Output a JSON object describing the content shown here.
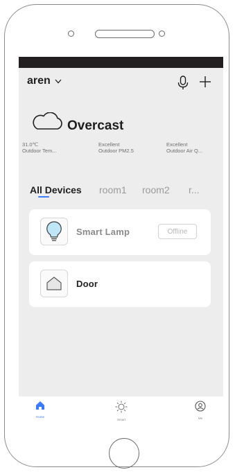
{
  "header": {
    "home_name": "aren"
  },
  "weather": {
    "condition": "Overcast",
    "stats": [
      {
        "value": "31.0℃",
        "label": "Outdoor Tem..."
      },
      {
        "value": "Excellent",
        "label": "Outdoor PM2.5"
      },
      {
        "value": "Excellent",
        "label": "Outdoor Air Q..."
      }
    ]
  },
  "tabs": [
    {
      "label": "All Devices",
      "active": true
    },
    {
      "label": "room1",
      "active": false
    },
    {
      "label": "room2",
      "active": false
    },
    {
      "label": "r...",
      "active": false
    }
  ],
  "devices": [
    {
      "name": "Smart  Lamp",
      "icon": "lightbulb-icon",
      "status": "Offline"
    },
    {
      "name": "Door",
      "icon": "house-icon",
      "status": ""
    }
  ],
  "tabbar": {
    "items": [
      {
        "label": "Home",
        "icon": "home-icon",
        "active": true
      },
      {
        "label": "Smart",
        "icon": "sun-icon",
        "active": false
      },
      {
        "label": "Me",
        "icon": "profile-icon",
        "active": false
      }
    ]
  },
  "colors": {
    "accent": "#3b7bff",
    "screen_background": "#ededed",
    "status_bar": "#231f20"
  }
}
